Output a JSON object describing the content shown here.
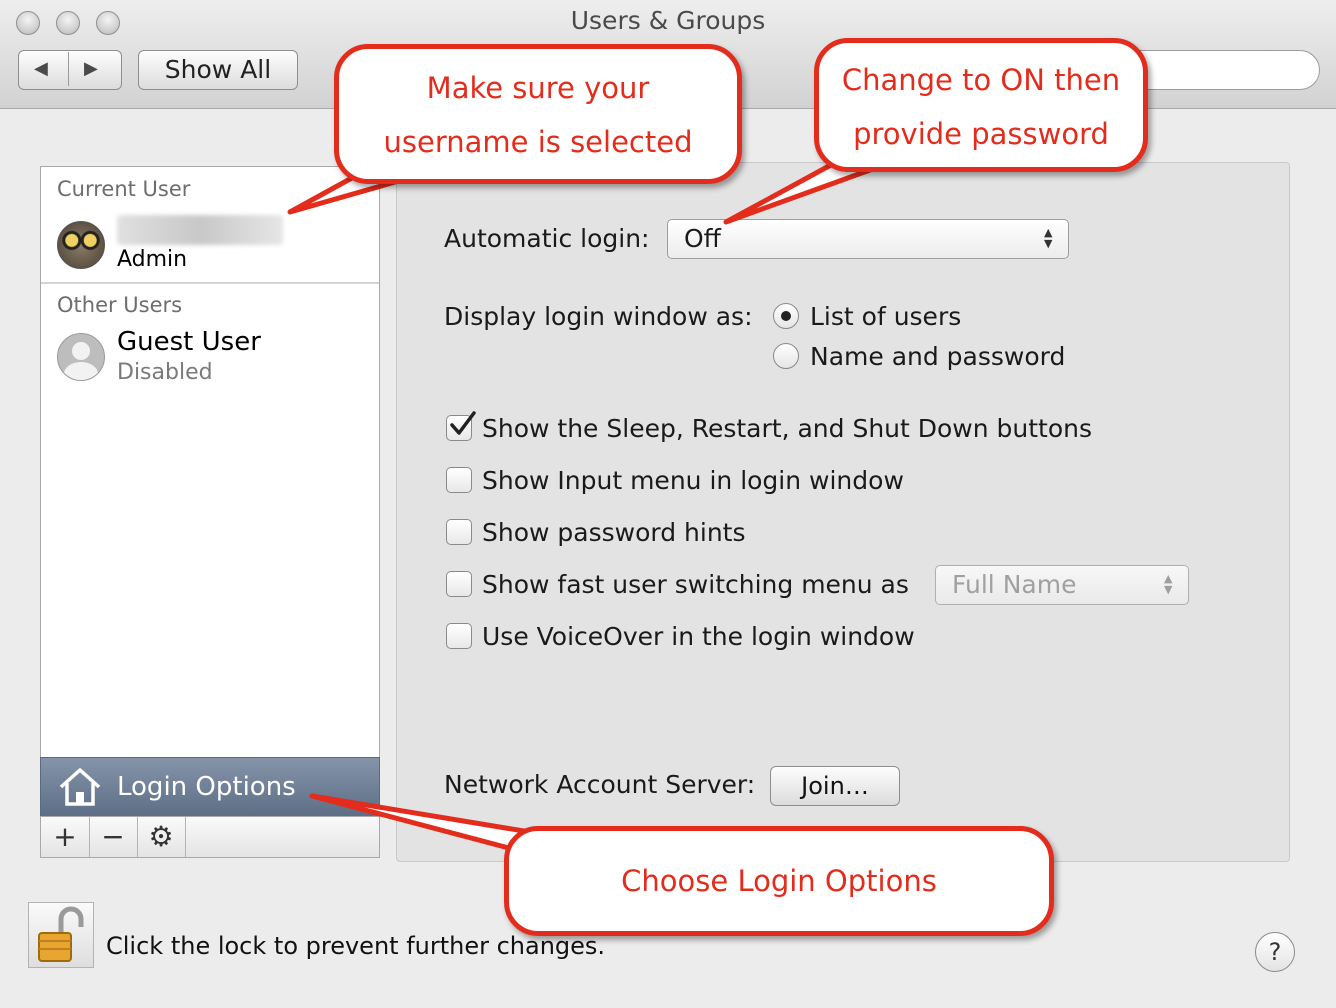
{
  "window": {
    "title": "Users & Groups"
  },
  "toolbar": {
    "back_label": "◀",
    "forward_label": "▶",
    "show_all_label": "Show All",
    "search_placeholder": ""
  },
  "sidebar": {
    "current_user_header": "Current User",
    "current_user": {
      "role": "Admin"
    },
    "other_users_header": "Other Users",
    "guest": {
      "name": "Guest User",
      "status": "Disabled"
    },
    "login_options_label": "Login Options",
    "add_label": "+",
    "remove_label": "−",
    "gear_label": "⚙"
  },
  "main": {
    "automatic_login_label": "Automatic login:",
    "automatic_login_value": "Off",
    "display_login_label": "Display login window as:",
    "radio_options": [
      {
        "label": "List of users",
        "selected": true
      },
      {
        "label": "Name and password",
        "selected": false
      }
    ],
    "checkboxes": [
      {
        "label": "Show the Sleep, Restart, and Shut Down buttons",
        "checked": true
      },
      {
        "label": "Show Input menu in login window",
        "checked": false
      },
      {
        "label": "Show password hints",
        "checked": false
      },
      {
        "label": "Show fast user switching menu as",
        "checked": false
      },
      {
        "label": "Use VoiceOver in the login window",
        "checked": false
      }
    ],
    "fast_switching_value": "Full Name",
    "network_server_label": "Network Account Server:",
    "join_label": "Join…"
  },
  "footer": {
    "lock_text": "Click the lock to prevent further changes.",
    "help_label": "?"
  },
  "callouts": {
    "username": [
      "Make sure your",
      "username is selected"
    ],
    "password": [
      "Change to ON then",
      "provide password"
    ],
    "login_options": "Choose Login Options"
  },
  "colors": {
    "callout": "#e32c1c",
    "selection": "#6b7b93"
  }
}
